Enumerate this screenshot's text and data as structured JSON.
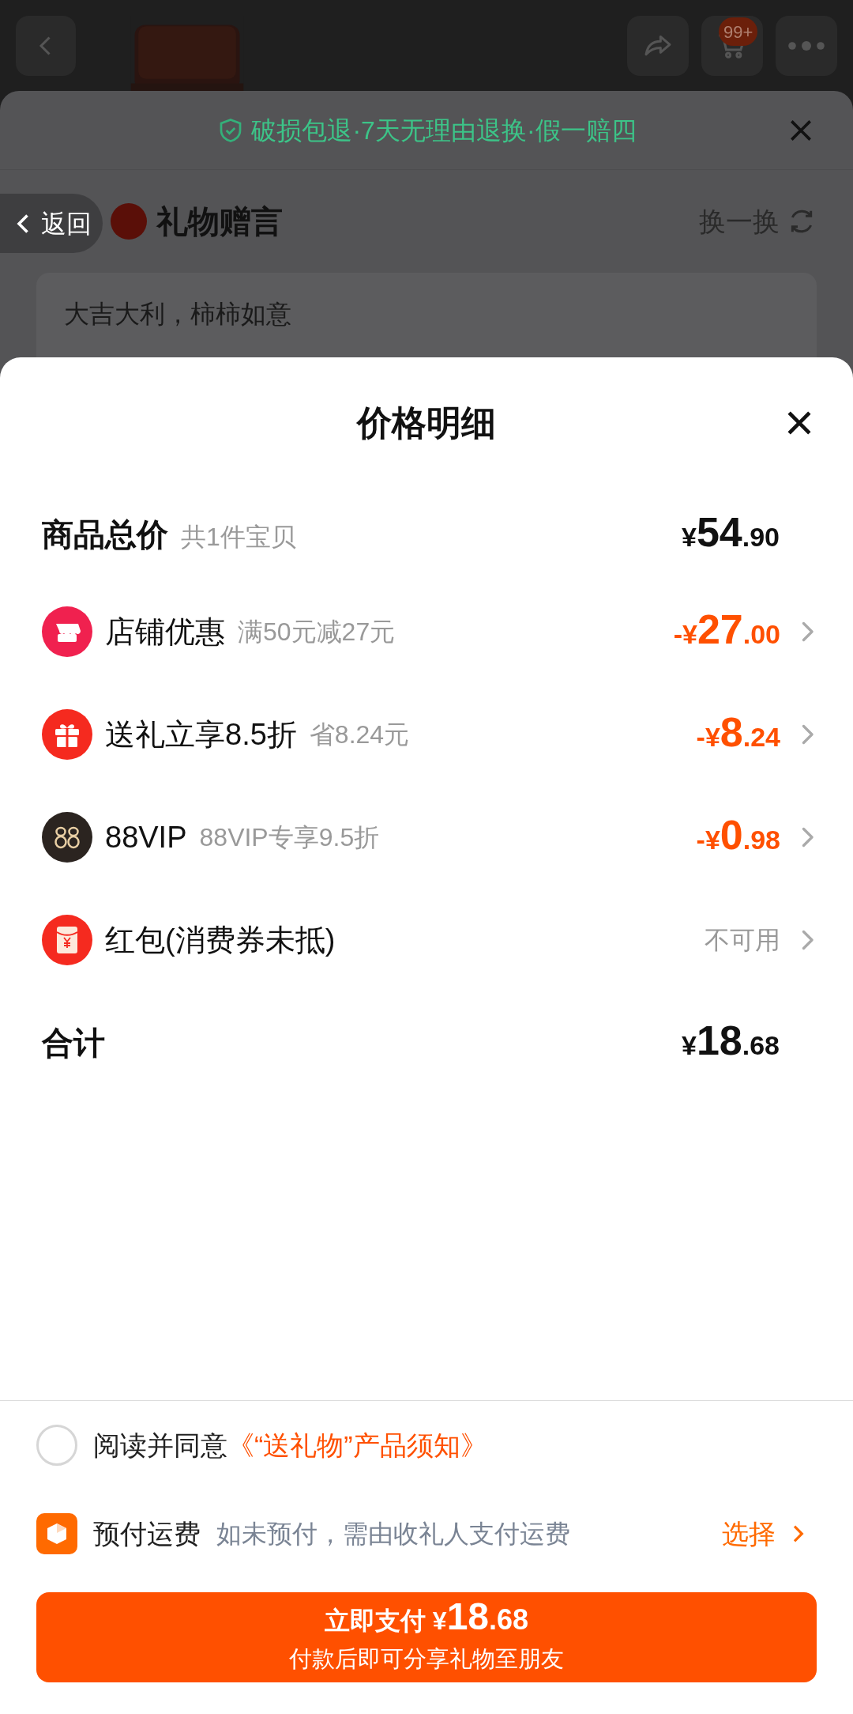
{
  "top_bar": {
    "cart_badge": "99+"
  },
  "background_sheet": {
    "guarantee": "破损包退·7天无理由退换·假一赔四",
    "back_label": "返回",
    "title": "礼物赠言",
    "refresh": "换一换",
    "message": "大吉大利，柿柿如意"
  },
  "price_sheet": {
    "title": "价格明细",
    "subtotal": {
      "label": "商品总价",
      "note": "共1件宝贝",
      "symbol": "¥",
      "integer": "54",
      "decimal": ".90"
    },
    "items": [
      {
        "kind": "store",
        "label": "店铺优惠",
        "note": "满50元减27元",
        "prefix": "-¥",
        "integer": "27",
        "decimal": ".00"
      },
      {
        "kind": "gift",
        "label": "送礼立享8.5折",
        "note": "省8.24元",
        "prefix": "-¥",
        "integer": "8",
        "decimal": ".24"
      },
      {
        "kind": "vip",
        "label": "88VIP",
        "note": "88VIP专享9.5折",
        "prefix": "-¥",
        "integer": "0",
        "decimal": ".98"
      },
      {
        "kind": "redpacket",
        "label": "红包(消费券未抵)",
        "status": "不可用"
      }
    ],
    "total": {
      "label": "合计",
      "symbol": "¥",
      "integer": "18",
      "decimal": ".68"
    }
  },
  "agreement": {
    "checked": false,
    "text": "阅读并同意",
    "link": "《“送礼物”产品须知》"
  },
  "prepay": {
    "label": "预付运费",
    "note": "如未预付，需由收礼人支付运费",
    "action": "选择"
  },
  "pay_button": {
    "label": "立即支付",
    "symbol": "¥",
    "integer": "18",
    "decimal": ".68",
    "subtitle": "付款后即可分享礼物至朋友"
  }
}
